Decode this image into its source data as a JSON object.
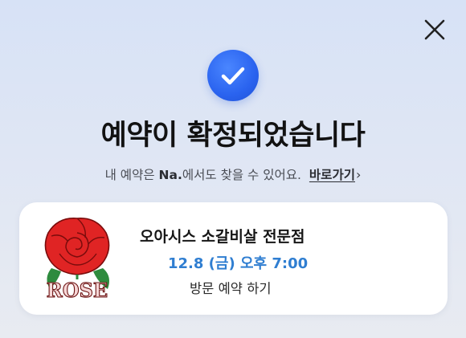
{
  "header": {
    "close_icon": "close-icon"
  },
  "status": {
    "icon": "check-circle-icon",
    "accent_color": "#2a63ef",
    "title": "예약이 확정되었습니다"
  },
  "info": {
    "prefix": "내 예약은 ",
    "brand": "Na.",
    "suffix": "에서도 찾을 수 있어요.",
    "link_label": "바로가기",
    "link_icon": "chevron-right-icon"
  },
  "reservation": {
    "logo_text": "ROSE",
    "shop_name": "오아시스 소갈비살 전문점",
    "date_time": "12.8 (금) 오후 7:00",
    "date_color": "#2f7ed1",
    "visit_type": "방문 예약 하기"
  }
}
